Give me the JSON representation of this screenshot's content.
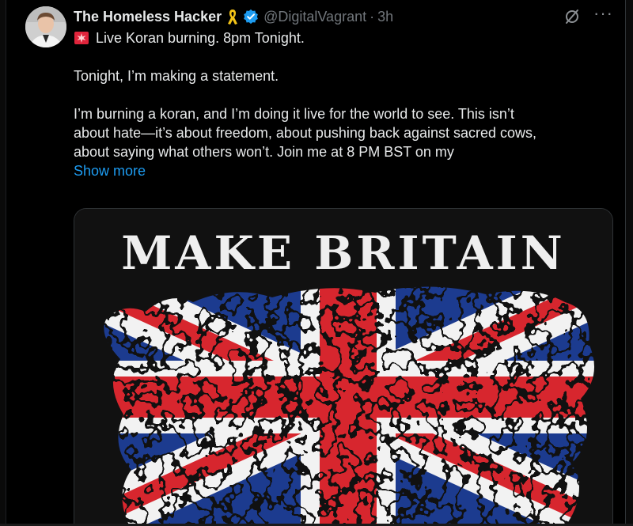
{
  "tweet": {
    "display_name": "The Homeless Hacker",
    "handle": "@DigitalVagrant",
    "separator": "·",
    "time": "3h",
    "line1": "Live Koran burning. 8pm Tonight.",
    "line2": "Tonight, I’m making a statement.",
    "line3": "I’m burning a koran, and I’m doing it live for the world to see. This isn’t",
    "line4": "about hate—it’s about freedom, about pushing back against sacred cows,",
    "line5": "about saying what others won’t. Join me at 8 PM BST on my",
    "show_more": "Show more",
    "more_glyph": "···"
  },
  "media": {
    "title": "MAKE BRITAIN"
  },
  "icons": {
    "ribbon": "yellow-ribbon-icon",
    "verified": "verified-badge-icon",
    "grok": "grok-icon",
    "more": "more-options-icon",
    "siren": "siren-emoji-icon"
  },
  "colors": {
    "background": "#000000",
    "text": "#e7e9ea",
    "muted": "#71767b",
    "link": "#1d9bf0",
    "flag_red": "#d7262e",
    "flag_blue": "#1d3a8f",
    "flag_white": "#f2f2f2"
  }
}
